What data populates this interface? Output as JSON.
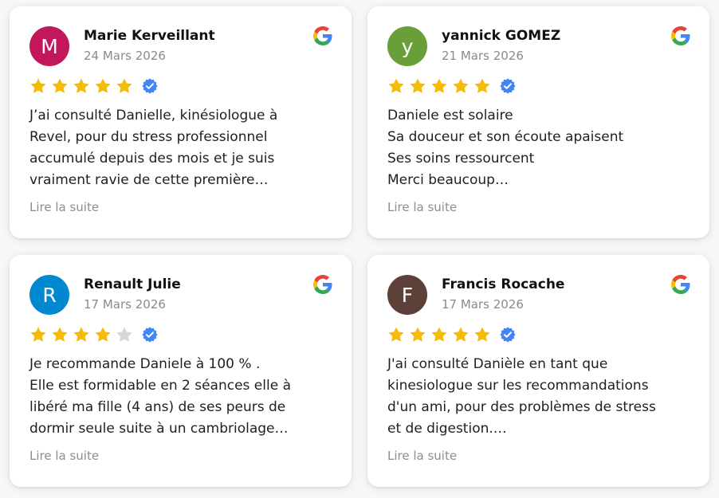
{
  "colors": {
    "star_filled": "#f6bb06",
    "star_empty": "#d6d6d6",
    "verified": "#4285f4",
    "google_blue": "#4285F4",
    "google_red": "#EA4335",
    "google_yellow": "#FBBC05",
    "google_green": "#34A853"
  },
  "reviews": [
    {
      "initial": "M",
      "avatar_color": "#c2185b",
      "name": "Marie Kerveillant",
      "date": "24 Mars 2026",
      "rating": 5,
      "lines": [
        "J’ai consulté Danielle, kinésiologue à",
        "Revel, pour du stress professionnel",
        "accumulé depuis des mois et je suis",
        "vraiment ravie de cette première…"
      ],
      "read_more": "Lire la suite"
    },
    {
      "initial": "y",
      "avatar_color": "#689f38",
      "name": "yannick GOMEZ",
      "date": "21 Mars 2026",
      "rating": 5,
      "lines": [
        "Daniele est solaire",
        "Sa douceur et son écoute apaisent",
        "Ses soins ressourcent",
        "Merci beaucoup…"
      ],
      "read_more": "Lire la suite"
    },
    {
      "initial": "R",
      "avatar_color": "#0288d1",
      "name": "Renault Julie",
      "date": "17 Mars 2026",
      "rating": 4,
      "lines": [
        "Je recommande Daniele à 100 % .",
        "Elle est formidable en 2 séances elle à",
        "libéré ma fille (4 ans) de ses peurs de",
        "dormir seule suite à un cambriolage…"
      ],
      "read_more": "Lire la suite"
    },
    {
      "initial": "F",
      "avatar_color": "#5d4037",
      "name": "Francis Rocache",
      "date": "17 Mars 2026",
      "rating": 5,
      "lines": [
        "J'ai consulté Danièle en tant que",
        "kinesiologue sur les recommandations",
        "d'un ami, pour des problèmes de stress",
        "et de digestion.…"
      ],
      "read_more": "Lire la suite"
    }
  ]
}
